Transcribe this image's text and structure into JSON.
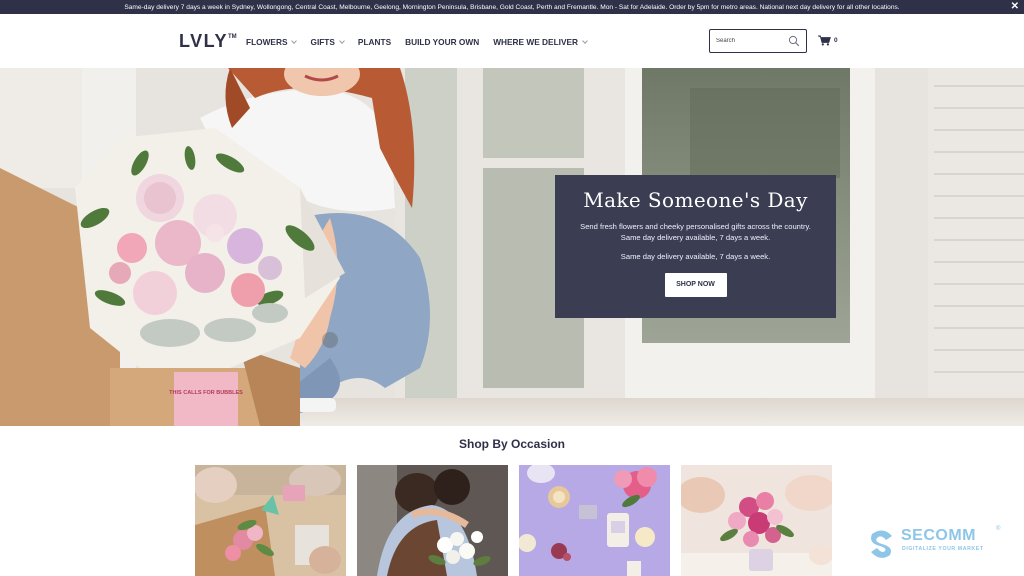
{
  "announcement": {
    "text": "Same-day delivery 7 days a week in Sydney, Wollongong, Central Coast, Melbourne, Geelong, Mornington Peninsula, Brisbane, Gold Coast, Perth and Fremantle. Mon - Sat for Adelaide. Order by 5pm for metro areas. National next day delivery for all other locations.",
    "close_icon": "close-icon"
  },
  "header": {
    "logo": "LVLY",
    "logo_mark": "TM",
    "nav": [
      {
        "label": "FLOWERS",
        "dropdown": true
      },
      {
        "label": "GIFTS",
        "dropdown": true
      },
      {
        "label": "PLANTS",
        "dropdown": false
      },
      {
        "label": "BUILD YOUR OWN",
        "dropdown": false
      },
      {
        "label": "WHERE WE DELIVER",
        "dropdown": true
      }
    ],
    "search": {
      "placeholder": "Search",
      "value": "",
      "icon": "search-icon"
    },
    "cart": {
      "icon": "cart-icon",
      "count": "0"
    }
  },
  "hero": {
    "title": "Make Someone's Day",
    "subtitle": "Send fresh flowers and cheeky personalised gifts across the country. Same day delivery available, 7 days a week.",
    "subtitle2": "Same day delivery available, 7 days a week.",
    "button": "SHOP NOW",
    "card_text": "THIS CALLS FOR BUBBLES"
  },
  "occasions": {
    "title": "Shop By Occasion",
    "tiles": [
      "tile-gift-unboxing",
      "tile-hug",
      "tile-flatlay",
      "tile-celebration"
    ]
  },
  "watermark": {
    "name": "SECOMM",
    "tagline": "DIGITALIZE YOUR MARKET",
    "reg": "®"
  },
  "colors": {
    "navy": "#2e3147",
    "card": "#3b3e52",
    "accent_pink": "#e89bb0",
    "watermark": "#8ec6e8"
  }
}
